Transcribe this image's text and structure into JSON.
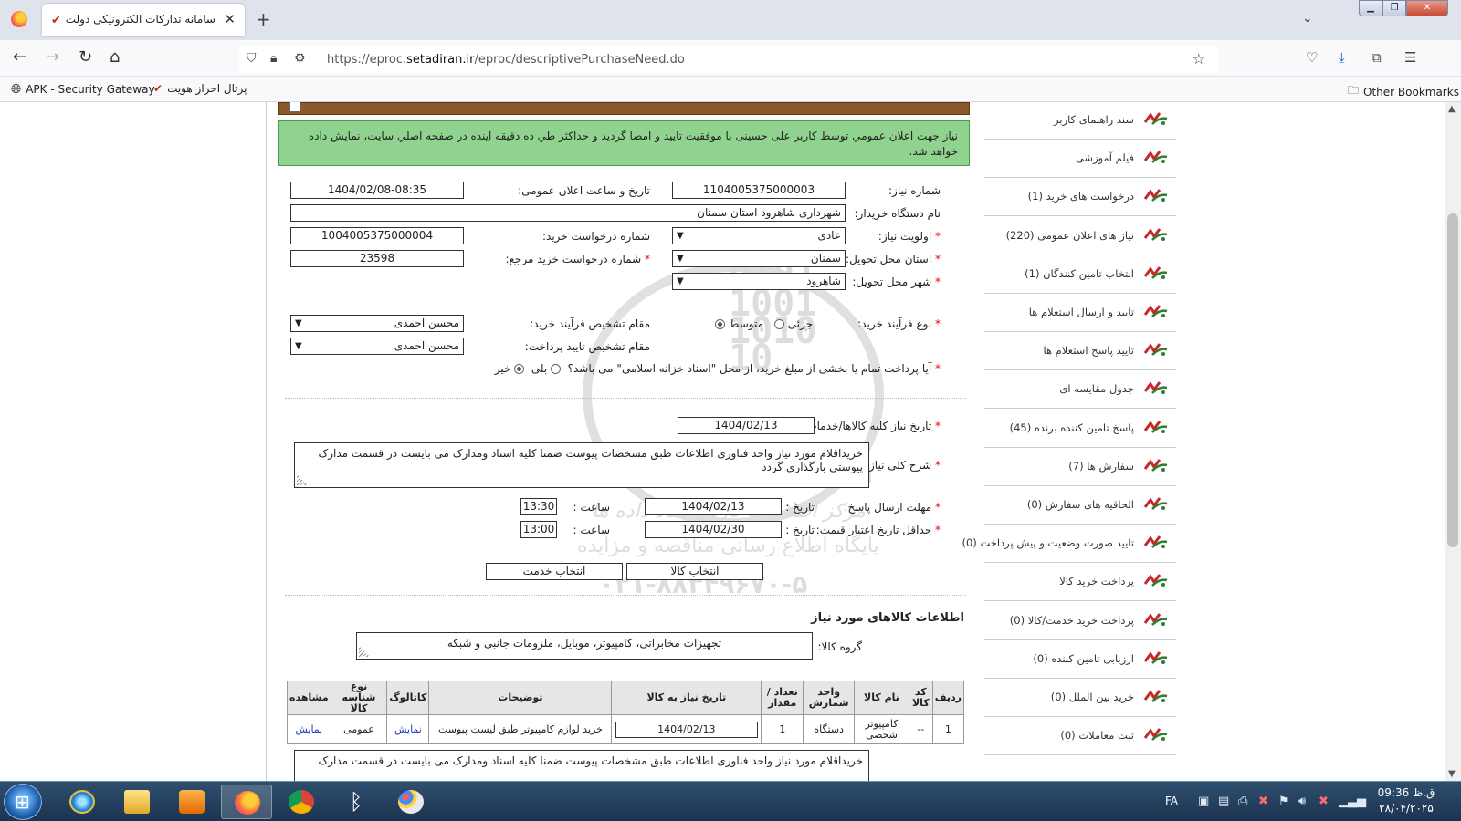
{
  "browser": {
    "tab_title": "سامانه تدارکات الکترونیکی دولت",
    "url_prefix": "https://eproc.",
    "url_domain": "setadiran.ir",
    "url_path": "/eproc/descriptivePurchaseNeed.do",
    "bookmarks": [
      "APK - Security Gateway",
      "پرتال احراز هویت"
    ],
    "other_bookmarks": "Other Bookmarks"
  },
  "notice": "نیاز جهت اعلان عمومي توسط کاربر علی حسینی با موفقیت تایید و امضا گردید و حداکثر طي ده دقيقه آینده در صفحه اصلي سایت، نمایش داده خواهد شد.",
  "form": {
    "need_number_label": "شماره نیاز:",
    "need_number": "1104005375000003",
    "announce_dt_label": "تاریخ و ساعت اعلان عمومی:",
    "announce_dt": "1404/02/08-08:35",
    "buyer_label": "نام دستگاه خریدار:",
    "buyer": "شهرداری شاهرود استان سمنان",
    "priority_label": "اولویت نیاز:",
    "priority": "عادی",
    "request_no_label": "شماره درخواست خرید:",
    "request_no": "1004005375000004",
    "province_label": "استان محل تحویل:",
    "province": "سمنان",
    "ref_request_label": "شماره درخواست خرید مرجع:",
    "ref_request": "23598",
    "city_label": "شهر محل تحویل:",
    "city": "شاهرود",
    "process_type_label": "نوع فرآیند خرید:",
    "process_partial": "جزئی",
    "process_medium": "متوسط",
    "process_authority_label": "مقام تشخیص فرآیند خرید:",
    "process_authority": "محسن احمدی",
    "payment_authority_label": "مقام تشخیص تایید پرداخت:",
    "payment_authority": "محسن احمدی",
    "treasury_question": "آیا پرداخت تمام یا بخشی از مبلغ خرید، از محل \"اسناد خزانه اسلامی\" می باشد؟",
    "yes": "بلی",
    "no": "خیر",
    "need_date_label": "تاریخ نیاز کلیه کالاها/خدمات :",
    "need_date": "1404/02/13",
    "description_label": "شرح کلی نیاز:",
    "description": "خریداقلام مورد نیاز واحد فناوری اطلاعات طبق مشخصات پیوست ضمنا کلیه اسناد ومدارک می بایست در قسمت مدارک پیوستی بارگذاری گردد",
    "reply_deadline_label": "مهلت ارسال پاسخ:",
    "date_label": "تاریخ :",
    "time_label": "ساعت :",
    "reply_date": "1404/02/13",
    "reply_time": "13:30",
    "price_validity_label": "حداقل تاریخ اعتبار قیمت:",
    "price_date": "1404/02/30",
    "price_time": "13:00",
    "select_goods": "انتخاب کالا",
    "select_service": "انتخاب خدمت"
  },
  "goods": {
    "section_title": "اطلاعات کالاهای مورد نیاز",
    "group_label": "گروه کالا:",
    "group_value": "تجهیزات مخابراتی، کامپیوتر، موبایل، ملزومات جانبی و شبکه",
    "columns": [
      "ردیف",
      "کد کالا",
      "نام کالا",
      "واحد شمارش",
      "تعداد / مقدار",
      "تاریخ نیاز به کالا",
      "توضیحات",
      "کاتالوگ",
      "نوع شناسه کالا",
      "مشاهده"
    ],
    "rows": [
      {
        "row": "1",
        "code": "--",
        "name": "کامپیوتر شخصی",
        "unit": "دستگاه",
        "qty": "1",
        "date": "1404/02/13",
        "desc": "خرید لوازم کامپیوتر طبق لیست پیوست",
        "catalog": "نمایش",
        "id_type": "عمومی",
        "view": "نمایش"
      }
    ],
    "bottom_text": "خریداقلام مورد نیاز واحد فناوری اطلاعات طبق مشخصات پیوست ضمنا کلیه اسناد ومدارک می بایست در قسمت مدارک"
  },
  "sidebar": [
    "سند راهنمای کاربر",
    "فیلم آموزشی",
    "درخواست های خرید (1)",
    "نیاز های اعلان عمومی (220)",
    "انتخاب تامین کنندگان (1)",
    "تایید و ارسال استعلام ها",
    "تایید پاسخ استعلام ها",
    "جدول مقایسه ای",
    "پاسخ تامین کننده برنده (45)",
    "سفارش ها (7)",
    "الحاقیه های سفارش (0)",
    "تایید صورت وضعیت و پیش پرداخت (0)",
    "پرداخت خرید کالا",
    "پرداخت خرید خدمت/کالا (0)",
    "ارزیابی تامین کننده (0)",
    "خرید بین الملل (0)",
    "ثبت معاملات (0)"
  ],
  "watermark": {
    "brand": "ParsNamadData",
    "line1": "مرکز اطلاعات پارس نماد داده ها",
    "line2": "پایگاه اطلاع رسانی مناقصه و مزایده",
    "phone": "۰۲۱-۸۸۳۴۹۶۷۰-۵",
    "binary": "0101\n1001\n1010\n10"
  },
  "taskbar": {
    "lang": "FA",
    "time": "09:36 ق.ظ",
    "date": "۲۸/۰۴/۲۰۲۵"
  },
  "colors": {
    "notice_bg": "#8fd38f",
    "header_bar": "#8b5a2b",
    "link": "#1a37c9",
    "required": "#e00000"
  }
}
